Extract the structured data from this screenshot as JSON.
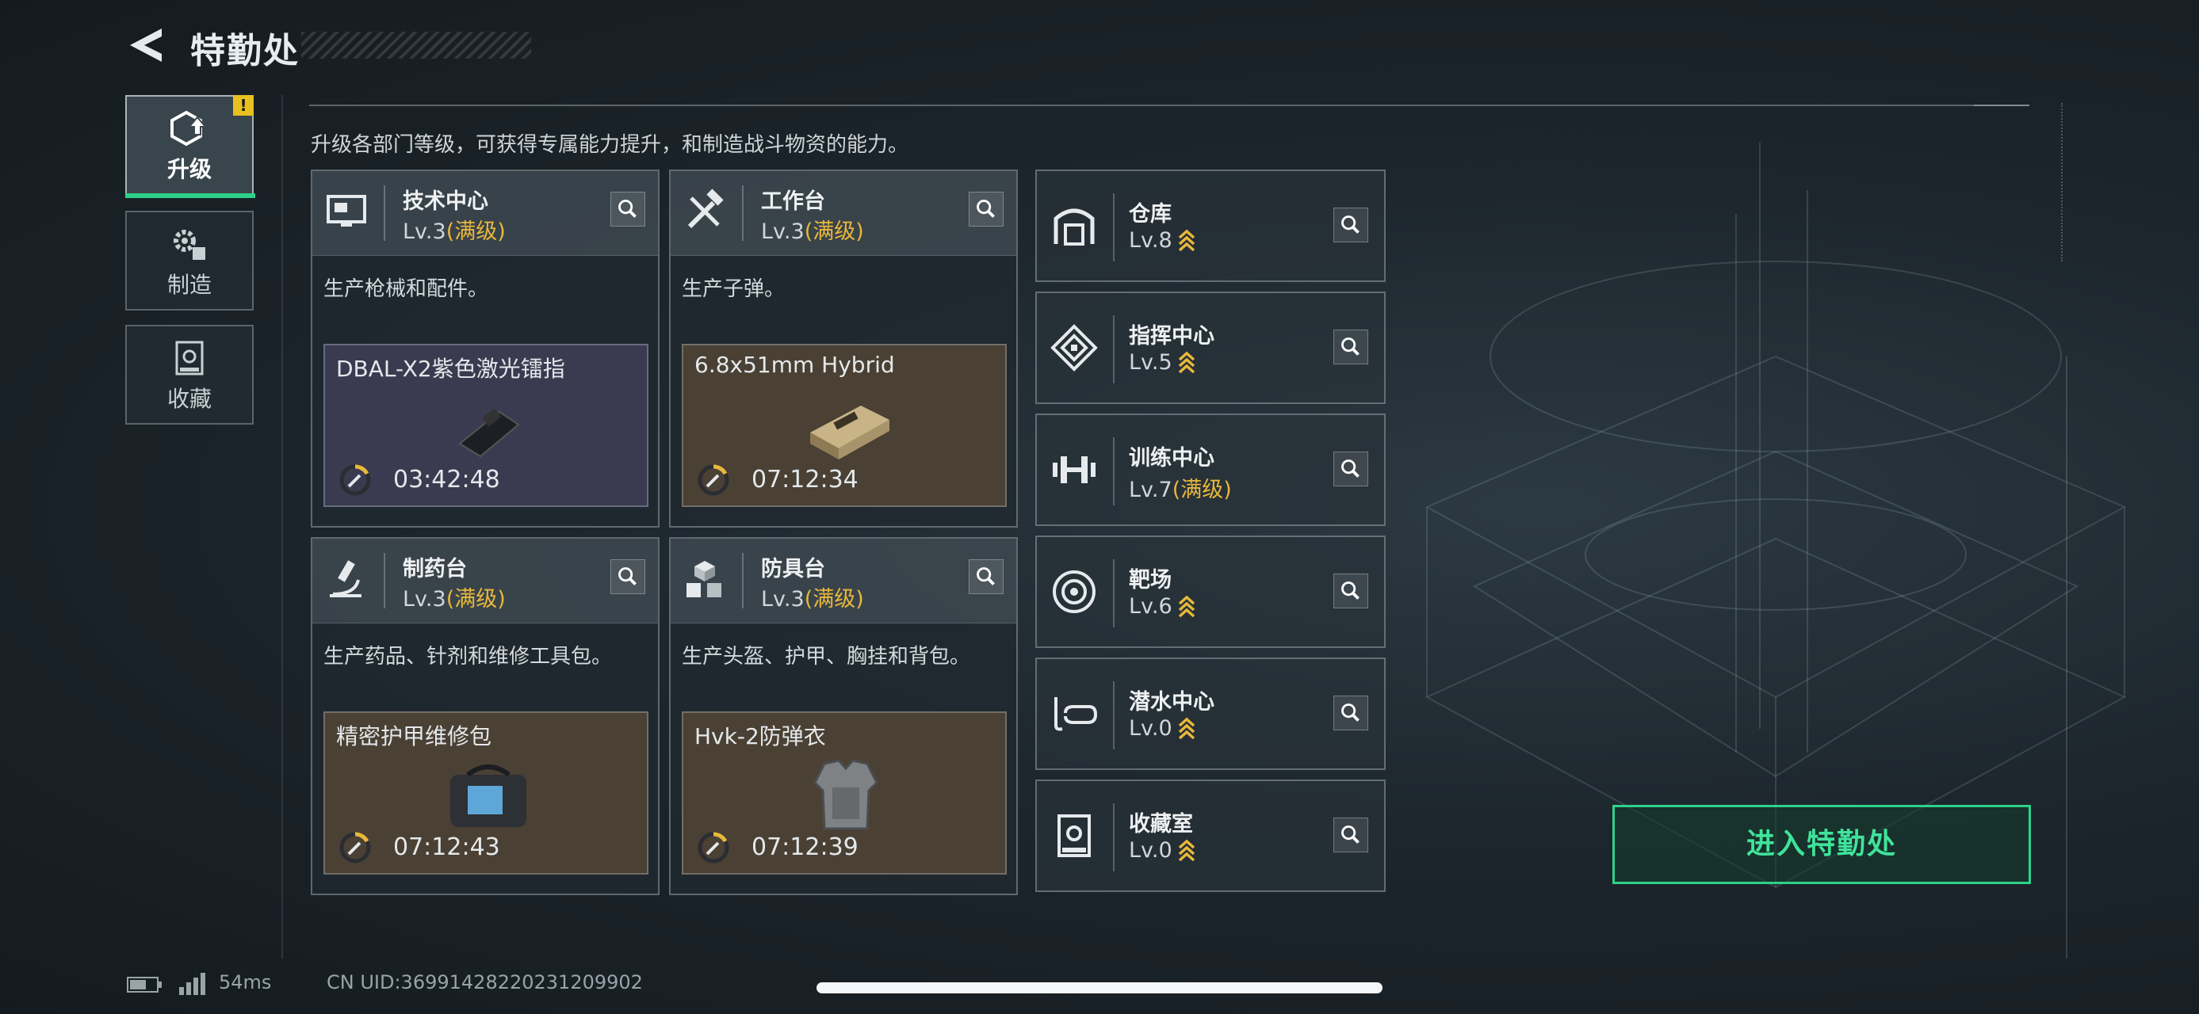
{
  "header": {
    "title": "特勤处",
    "description": "升级各部门等级，可获得专属能力提升，和制造战斗物资的能力。"
  },
  "sidebar": {
    "warning_badge": "!",
    "tabs": [
      {
        "label": "升级",
        "icon": "upgrade-icon",
        "active": true
      },
      {
        "label": "制造",
        "icon": "gears-icon",
        "active": false
      },
      {
        "label": "收藏",
        "icon": "collection-icon",
        "active": false
      }
    ]
  },
  "cards": [
    {
      "name": "技术中心",
      "level": "Lv.3",
      "max": "(满级)",
      "desc": "生产枪械和配件。",
      "product": "DBAL-X2紫色激光镭指",
      "timer": "03:42:48",
      "icon": "monitor-icon",
      "product_icon": "laser-device-icon"
    },
    {
      "name": "工作台",
      "level": "Lv.3",
      "max": "(满级)",
      "desc": "生产子弹。",
      "product": "6.8x51mm Hybrid",
      "timer": "07:12:34",
      "icon": "tools-icon",
      "product_icon": "ammo-box-icon"
    },
    {
      "name": "制药台",
      "level": "Lv.3",
      "max": "(满级)",
      "desc": "生产药品、针剂和维修工具包。",
      "product": "精密护甲维修包",
      "timer": "07:12:43",
      "icon": "microscope-icon",
      "product_icon": "repair-kit-icon"
    },
    {
      "name": "防具台",
      "level": "Lv.3",
      "max": "(满级)",
      "desc": "生产头盔、护甲、胸挂和背包。",
      "product": "Hvk-2防弹衣",
      "timer": "07:12:39",
      "icon": "boxes-icon",
      "product_icon": "body-armor-icon"
    }
  ],
  "facilities": [
    {
      "name": "仓库",
      "level": "Lv.8",
      "max": "",
      "upgradable": true,
      "icon": "warehouse-icon"
    },
    {
      "name": "指挥中心",
      "level": "Lv.5",
      "max": "",
      "upgradable": true,
      "icon": "command-icon"
    },
    {
      "name": "训练中心",
      "level": "Lv.7",
      "max": "(满级)",
      "upgradable": false,
      "icon": "dumbbell-icon"
    },
    {
      "name": "靶场",
      "level": "Lv.6",
      "max": "",
      "upgradable": true,
      "icon": "target-icon"
    },
    {
      "name": "潜水中心",
      "level": "Lv.0",
      "max": "",
      "upgradable": true,
      "icon": "diving-mask-icon"
    },
    {
      "name": "收藏室",
      "level": "Lv.0",
      "max": "",
      "upgradable": true,
      "icon": "collection-room-icon"
    }
  ],
  "enter_button": "进入特勤处",
  "footer": {
    "ping": "54ms",
    "uid": "CN UID:36991428220231209902"
  },
  "colors": {
    "accent_green": "#2ed18a",
    "max_level_gold": "#e8b83c",
    "warning_yellow": "#e8c020"
  }
}
